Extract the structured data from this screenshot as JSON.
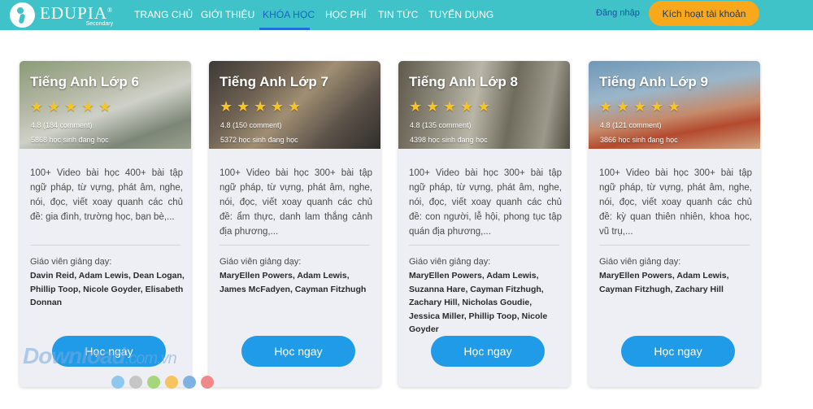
{
  "header": {
    "brand": "EDUPIA",
    "brand_mark": "®",
    "brand_sub": "Secondary",
    "nav": [
      {
        "label": "TRANG CHỦ",
        "active": false
      },
      {
        "label": "GIỚI THIỆU",
        "active": false
      },
      {
        "label": "KHÓA HỌC",
        "active": true
      },
      {
        "label": "HỌC PHÍ",
        "active": false
      },
      {
        "label": "TIN TỨC",
        "active": false
      },
      {
        "label": "TUYỂN DỤNG",
        "active": false
      }
    ],
    "login_label": "Đăng nhập",
    "activate_label": "Kích hoạt tài khoản"
  },
  "colors": {
    "navbar": "#3fc3c8",
    "accent_orange": "#f9a81b",
    "button_blue": "#1f9be8",
    "star": "#f7c325"
  },
  "cards": [
    {
      "title": "Tiếng Anh Lớp 6",
      "stars": 5,
      "rating": "4.8 (184 comment)",
      "students": "5868 học sinh đang học",
      "description": "100+ Video bài học 400+ bài tập ngữ pháp, từ vựng, phát âm, nghe, nói, đọc, viết xoay quanh các chủ đề: gia đình, trường học, bạn bè,...",
      "teacher_label": "Giáo viên giảng dạy:",
      "teachers": "Davin Reid, Adam Lewis, Dean Logan, Phillip Toop, Nicole Goyder, Elisabeth Donnan",
      "button": "Học ngay"
    },
    {
      "title": "Tiếng Anh Lớp 7",
      "stars": 5,
      "rating": "4.8 (150 comment)",
      "students": "5372 học sinh đang học",
      "description": "100+ Video bài học 300+ bài tập ngữ pháp, từ vựng, phát âm, nghe, nói, đọc, viết xoay quanh các chủ đề: ẩm thực, danh lam thắng cảnh địa phương,...",
      "teacher_label": "Giáo viên giảng dạy:",
      "teachers": "MaryEllen Powers, Adam Lewis, James McFadyen, Cayman Fitzhugh",
      "button": "Học ngay"
    },
    {
      "title": "Tiếng Anh Lớp 8",
      "stars": 5,
      "rating": "4.8 (135 comment)",
      "students": "4398 học sinh đang học",
      "description": "100+ Video bài học 300+ bài tập ngữ pháp, từ vựng, phát âm, nghe, nói, đọc, viết xoay quanh các chủ đề: con người, lễ hội, phong tục tập quán địa phương,...",
      "teacher_label": "Giáo viên giảng dạy:",
      "teachers": "MaryEllen Powers, Adam Lewis, Suzanna Hare, Cayman Fitzhugh, Zachary Hill, Nicholas Goudie, Jessica Miller, Phillip Toop, Nicole Goyder",
      "button": "Học ngay"
    },
    {
      "title": "Tiếng Anh Lớp 9",
      "stars": 5,
      "rating": "4.8 (121 comment)",
      "students": "3866 học sinh đang học",
      "description": "100+ Video bài học 300+ bài tập ngữ pháp, từ vựng, phát âm, nghe, nói, đọc, viết xoay quanh các chủ đề: kỳ quan thiên nhiên, khoa học, vũ trụ,...",
      "teacher_label": "Giáo viên giảng dạy:",
      "teachers": "MaryEllen Powers, Adam Lewis, Cayman Fitzhugh, Zachary Hill",
      "button": "Học ngay"
    }
  ],
  "watermark": {
    "text": "Download",
    "suffix": ".com.vn",
    "dot_colors": [
      "#8fc8ee",
      "#c6c6c6",
      "#a5d67a",
      "#f6c35e",
      "#7fb2e2",
      "#f08a8a"
    ]
  }
}
